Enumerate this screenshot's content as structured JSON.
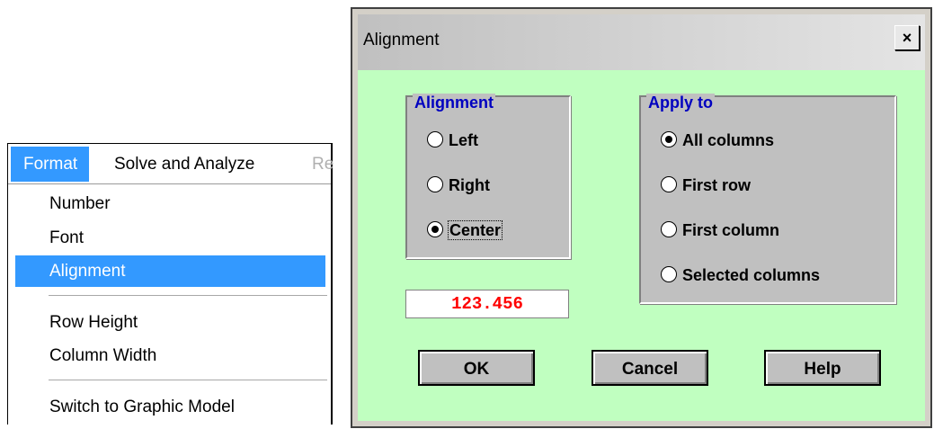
{
  "menu": {
    "bar": {
      "format": "Format",
      "solve": "Solve and Analyze",
      "more": "Re"
    },
    "items": {
      "number": "Number",
      "font": "Font",
      "alignment": "Alignment",
      "row_height": "Row Height",
      "column_width": "Column Width",
      "switch_model": "Switch to Graphic Model"
    }
  },
  "dialog": {
    "title": "Alignment",
    "close_glyph": "×",
    "alignment_group": {
      "label": "Alignment",
      "options": [
        "Left",
        "Right",
        "Center"
      ],
      "selected": "Center"
    },
    "apply_group": {
      "label": "Apply to",
      "options": [
        "All columns",
        "First row",
        "First column",
        "Selected columns"
      ],
      "selected": "All columns"
    },
    "preview_value": "123.456",
    "buttons": {
      "ok": "OK",
      "cancel": "Cancel",
      "help": "Help"
    }
  },
  "colors": {
    "highlight": "#3399ff",
    "dialog_background": "#c0ffc0",
    "group_label": "#0000c0",
    "preview_text": "#ff0000"
  }
}
